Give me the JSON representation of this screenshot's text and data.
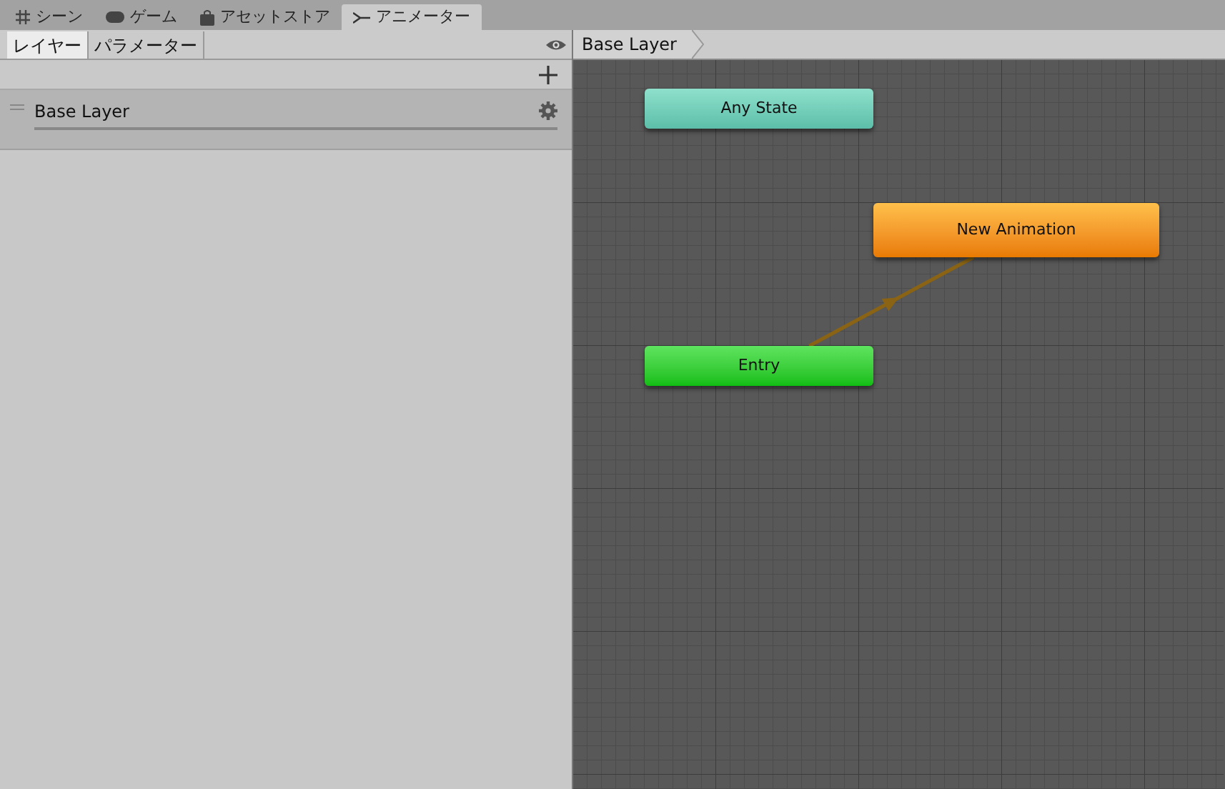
{
  "window_tabs": [
    {
      "label": "シーン",
      "selected": false
    },
    {
      "label": "ゲーム",
      "selected": false
    },
    {
      "label": "アセットストア",
      "selected": false
    },
    {
      "label": "アニメーター",
      "selected": true
    }
  ],
  "panel_tabs": [
    {
      "label": "レイヤー",
      "selected": true
    },
    {
      "label": "パラメーター",
      "selected": false
    }
  ],
  "layers": [
    {
      "name": "Base Layer"
    }
  ],
  "breadcrumb": "Base Layer",
  "states": [
    {
      "name": "Any State",
      "kind": "any"
    },
    {
      "name": "New Animation",
      "kind": "default"
    },
    {
      "name": "Entry",
      "kind": "entry"
    }
  ]
}
